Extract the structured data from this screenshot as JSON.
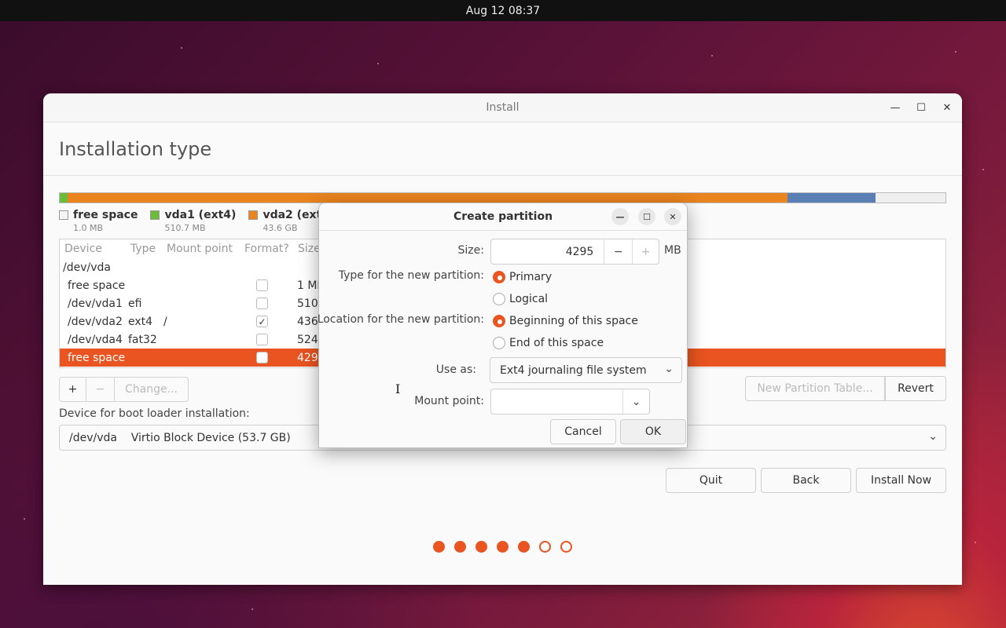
{
  "topbar": {
    "datetime": "Aug 12  08:37"
  },
  "window": {
    "title": "Install",
    "heading": "Installation type"
  },
  "colors": {
    "accent": "#e95420",
    "free": "#f4f4f4",
    "efi": "#6dbb3a",
    "ext4": "#e9841e",
    "fat32": "#5a7fb5"
  },
  "legend": [
    {
      "name": "free space",
      "size": "1.0 MB"
    },
    {
      "name": "vda1 (ext4)",
      "size": "510.7 MB"
    },
    {
      "name": "vda2 (ext4)",
      "size": "43.6 GB"
    }
  ],
  "table": {
    "headers": [
      "Device",
      "Type",
      "Mount point",
      "Format?",
      "Size"
    ],
    "rows": [
      {
        "device": "/dev/vda",
        "type": "",
        "mount": "",
        "size": ""
      },
      {
        "device": "free space",
        "type": "",
        "mount": "",
        "size": "1 MB"
      },
      {
        "device": "/dev/vda1",
        "type": "efi",
        "mount": "",
        "size": "510"
      },
      {
        "device": "/dev/vda2",
        "type": "ext4",
        "mount": "/",
        "size": "4361"
      },
      {
        "device": "/dev/vda4",
        "type": "fat32",
        "mount": "",
        "size": "5242"
      },
      {
        "device": "free space",
        "type": "",
        "mount": "",
        "size": "4294"
      }
    ]
  },
  "tools": {
    "add": "+",
    "remove": "−",
    "change": "Change...",
    "new_table": "New Partition Table...",
    "revert": "Revert"
  },
  "boot": {
    "label": "Device for boot loader installation:",
    "value": "/dev/vda    Virtio Block Device (53.7 GB)"
  },
  "buttons": {
    "quit": "Quit",
    "back": "Back",
    "install": "Install Now"
  },
  "progress": {
    "steps_total": 7,
    "steps_done": 5
  },
  "dialog": {
    "title": "Create partition",
    "size_label": "Size:",
    "size_value": "4295",
    "size_unit": "MB",
    "minus": "−",
    "plus": "+",
    "type_label": "Type for the new partition:",
    "type_primary": "Primary",
    "type_logical": "Logical",
    "location_label": "Location for the new partition:",
    "loc_begin": "Beginning of this space",
    "loc_end": "End of this space",
    "useas_label": "Use as:",
    "useas_value": "Ext4 journaling file system",
    "mount_label": "Mount point:",
    "mount_value": "",
    "cancel": "Cancel",
    "ok": "OK"
  }
}
